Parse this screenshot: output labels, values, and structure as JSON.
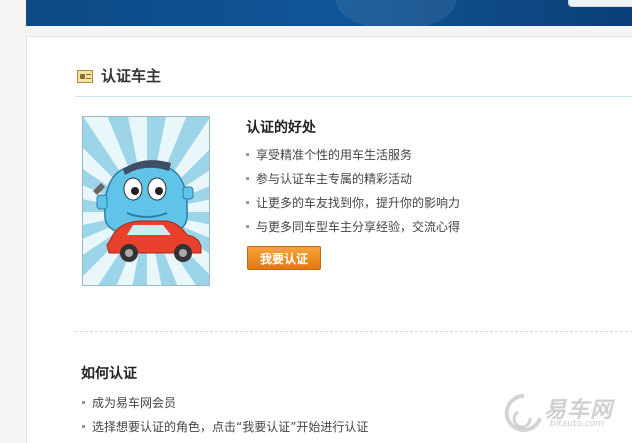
{
  "header": {
    "title": "认证车主"
  },
  "benefits": {
    "title": "认证的好处",
    "items": [
      "享受精准个性的用车生活服务",
      "参与认证车主专属的精彩活动",
      "让更多的车友找到你，提升你的影响力",
      "与更多同车型车主分享经验，交流心得"
    ],
    "button_label": "我要认证"
  },
  "how": {
    "title": "如何认证",
    "steps": [
      "成为易车网会员",
      "选择想要认证的角色，点击“我要认证”开始进行认证"
    ]
  },
  "watermark": {
    "brand": "易车网",
    "domain": "bitauto.com"
  },
  "colors": {
    "topbar": "#0f5597",
    "button": "#f08b1d",
    "mascot_body": "#5fc4e8",
    "mascot_car": "#e8402a"
  },
  "icons": {
    "header_icon": "id-card-icon",
    "watermark_icon": "bitauto-logo-icon"
  }
}
